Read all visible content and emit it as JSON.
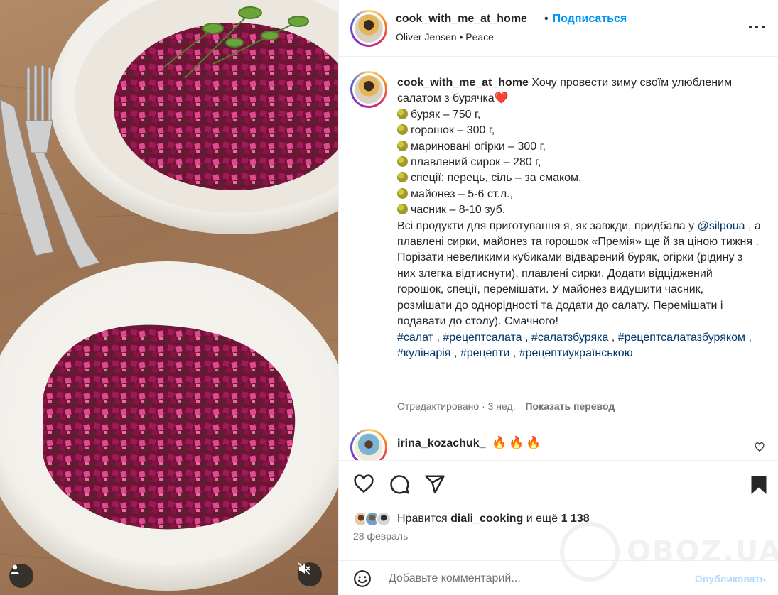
{
  "header": {
    "username": "cook_with_me_at_home",
    "separator": "•",
    "follow_label": "Подписаться",
    "sub_line": "Oliver Jensen • Peace",
    "more_icon": "more-horizontal-icon"
  },
  "caption": {
    "username": "cook_with_me_at_home",
    "intro": "Хочу провести зиму своїм улюбленим салатом з бурячка",
    "intro_emoji": "❤️",
    "ingredients": [
      "буряк – 750 г,",
      "горошок – 300 г,",
      "мариновані огірки – 300 г,",
      "плавлений сирок – 280 г,",
      "спеції: перець, сіль – за смаком,",
      "майонез – 5-6 ст.л.,",
      "часник – 8-10 зуб."
    ],
    "p1_before": "Всі продукти для приготування я, як завжди, придбала у",
    "mention": "@silpoua",
    "p1_after": ", а плавлені сирки, майонез та горошок «Премія» ще й за ціною тижня .",
    "p2": "Порізати невеликими кубиками відварений буряк, огірки (рідину з них злегка відтиснути), плавлені сирки. Додати відціджений горошок, спеції, перемішати. У майонез видушити часник, розмішати до однорідності та додати до салату. Перемішати і подавати до столу). Смачного!",
    "hashtags": [
      "#салат",
      "#рецептсалата",
      "#салатзбуряка",
      "#рецептсалатазбуряком",
      "#кулінарія",
      "#рецепти",
      "#рецептиукраїнською"
    ],
    "edited": "Отредактировано · 3 нед.",
    "translate": "Показать перевод"
  },
  "comment": {
    "username": "irina_kozachuk_",
    "text": "🔥🔥🔥"
  },
  "actions": {
    "like_icon": "heart-icon",
    "comment_icon": "comment-icon",
    "share_icon": "share-icon",
    "save_icon": "bookmark-icon"
  },
  "likes": {
    "prefix": "Нравится",
    "user": "diali_cooking",
    "middle": "и ещё",
    "count": "1 138"
  },
  "date": "28 февраль",
  "comment_box": {
    "placeholder": "Добавьте комментарий...",
    "publish": "Опубликовать"
  },
  "watermark": "OBOZ.UA"
}
